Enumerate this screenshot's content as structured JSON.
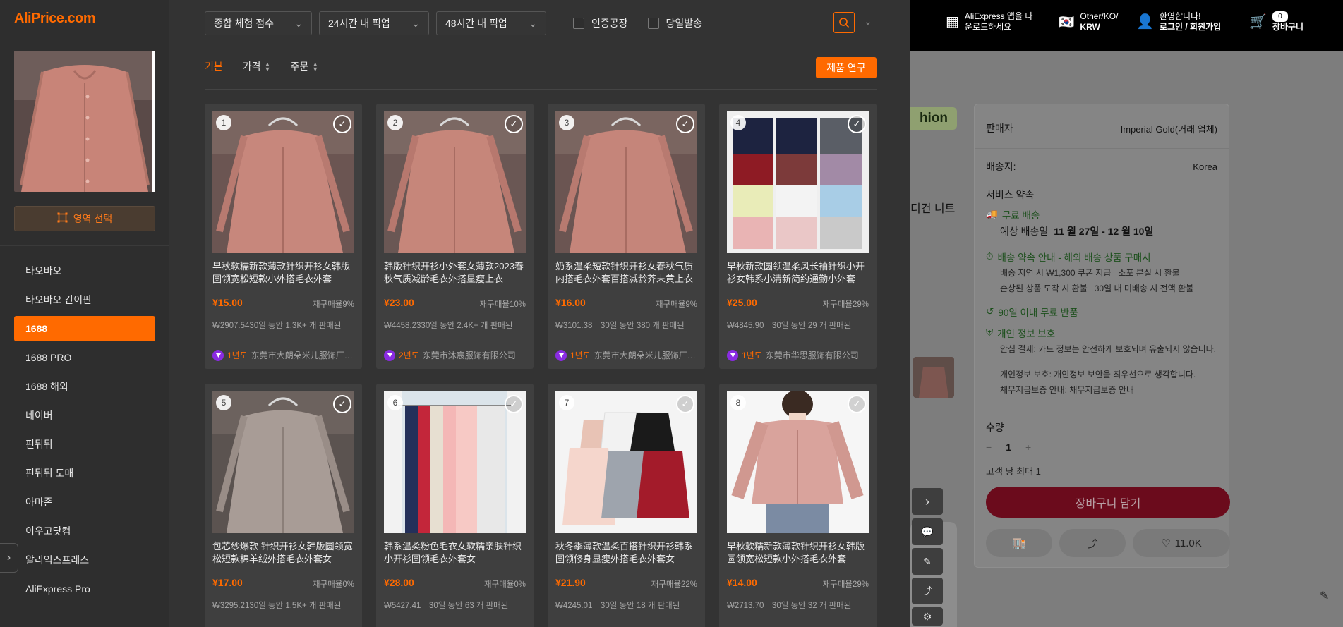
{
  "sidebar": {
    "logo": "AliPrice.com",
    "region_select": "영역 선택",
    "items": [
      {
        "label": "타오바오"
      },
      {
        "label": "타오바오 간이판"
      },
      {
        "label": "1688",
        "active": true
      },
      {
        "label": "1688 PRO"
      },
      {
        "label": "1688 해외"
      },
      {
        "label": "네이버"
      },
      {
        "label": "핀둬둬"
      },
      {
        "label": "핀둬둬 도매"
      },
      {
        "label": "아마존"
      },
      {
        "label": "이우고닷컴"
      },
      {
        "label": "알리익스프레스"
      },
      {
        "label": "AliExpress Pro"
      }
    ]
  },
  "filters": {
    "sort_select": "종합 체험 점수",
    "pickup_24": "24시간 내 픽업",
    "pickup_48": "48시간 내 픽업",
    "certified_factory": "인증공장",
    "same_day": "당일발송"
  },
  "sortbar": {
    "basic": "기본",
    "price": "가격",
    "order": "주문",
    "research_button": "제품 연구"
  },
  "colors": {
    "accent": "#ff6a00",
    "panel": "#333333",
    "card": "#3f3f3f"
  },
  "products": [
    {
      "num": "1",
      "title": "早秋软糯新款薄款针织开衫女韩版圆领宽松短款小外搭毛衣外套",
      "price": "¥15.00",
      "repeat": "재구매율9%",
      "sold": "₩2907.5430일 동안 1.3K+ 개 판매된",
      "years": "1년도",
      "shop": "东莞市大朗朵米儿服饰厂（个体工商户）"
    },
    {
      "num": "2",
      "title": "韩版针织开衫小外套女薄款2023春秋气质减龄毛衣外搭显瘦上衣",
      "price": "¥23.00",
      "repeat": "재구매율10%",
      "sold": "₩4458.2330일 동안 2.4K+ 개 판매된",
      "years": "2년도",
      "shop": "东莞市沐宸服饰有限公司"
    },
    {
      "num": "3",
      "title": "奶系温柔短款针织开衫女春秋气质内搭毛衣外套百搭减龄芥末黄上衣",
      "price": "¥16.00",
      "repeat": "재구매율9%",
      "sold": "₩3101.38　30일 동안 380 개 판매된",
      "years": "1년도",
      "shop": "东莞市大朗朵米儿服饰厂（个体工商户）"
    },
    {
      "num": "4",
      "title": "早秋新款圆领温柔风长袖针织小开衫女韩系小清新简约通勤小外套",
      "price": "¥25.00",
      "repeat": "재구매율29%",
      "sold": "₩4845.90　30일 동안 29 개 판매된",
      "years": "1년도",
      "shop": "东莞市华思服饰有限公司"
    },
    {
      "num": "5",
      "title": "包芯纱爆款 针织开衫女韩版圆领宽松短款棉羊绒外搭毛衣外套女",
      "price": "¥17.00",
      "repeat": "재구매율0%",
      "sold": "₩3295.2130일 동안 1.5K+ 개 판매된",
      "years": "",
      "shop": ""
    },
    {
      "num": "6",
      "title": "韩系温柔粉色毛衣女软糯亲肤针织小开衫圆领毛衣外套女",
      "price": "¥28.00",
      "repeat": "재구매율0%",
      "sold": "₩5427.41　30일 동안 63 개 판매된",
      "years": "",
      "shop": ""
    },
    {
      "num": "7",
      "title": "秋冬季薄款温柔百搭针织开衫韩系圆领修身显瘦外搭毛衣外套女",
      "price": "¥21.90",
      "repeat": "재구매율22%",
      "sold": "₩4245.01　30일 동안 18 개 판매된",
      "years": "",
      "shop": ""
    },
    {
      "num": "8",
      "title": "早秋软糯新款薄款针织开衫女韩版圆领宽松短款小外搭毛衣外套",
      "price": "¥14.00",
      "repeat": "재구매율29%",
      "sold": "₩2713.70　30일 동안 32 개 판매된",
      "years": "",
      "shop": ""
    }
  ],
  "background": {
    "app_promo": "AliExpress 앱을 다운로드하세요",
    "region_top": "Other/KO/",
    "currency": "KRW",
    "welcome": "환영합니다!",
    "login": "로그인 / 회원가입",
    "cart_count": "0",
    "cart_label": "장바구니",
    "tag_fashion": "hion",
    "side_title": "디건 니트",
    "seller_label": "판매자",
    "seller_value": "Imperial Gold(거래 업체)",
    "ship_to_label": "배송지:",
    "ship_to_value": "Korea",
    "service_label": "서비스 약속",
    "free_shipping": "무료 배송",
    "eta_label": "예상 배송일",
    "eta_value": "11 월 27일 - 12 월 10일",
    "delivery_promise": "배송 약속 안내 - 해외 배송 상품 구매시",
    "promise_1": "배송 지연 시 ₩1,300 쿠폰 지급",
    "promise_2": "소포 분실 시 환불",
    "promise_3": "손상된 상품 도착 시 환불",
    "promise_4": "30일 내 미배송 시 전액 환불",
    "free_return": "90일 이내 무료 반품",
    "privacy": "개인 정보 보호",
    "privacy_1": "안심 결제: 카드 정보는 안전하게 보호되며 유출되지 않습니다.",
    "privacy_2": "개인정보 보호: 개인정보 보안을 최우선으로 생각합니다.",
    "privacy_3": "채무지급보증 안내: 채무지급보증 안내",
    "qty_label": "수량",
    "qty_value": "1",
    "max_per_customer": "고객 당 최대 1",
    "add_to_cart": "장바구니 담기",
    "wishlist_count": "11.0K"
  }
}
